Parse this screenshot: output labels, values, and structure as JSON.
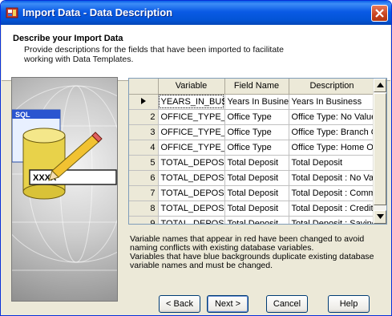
{
  "window": {
    "title": "Import Data - Data Description",
    "title_icon": "app-icon",
    "close_icon": "close-icon"
  },
  "header": {
    "title": "Describe your Import Data",
    "description": "Provide descriptions for the fields that have been imported to facilitate working with Data Templates."
  },
  "illustration": {
    "sql_label": "SQL",
    "field_label": "XXXX"
  },
  "grid": {
    "columns": [
      "Variable",
      "Field Name",
      "Description"
    ],
    "rows": [
      {
        "num": "",
        "variable": "YEARS_IN_BUSINESS",
        "field_name": "Years In Business",
        "description": "Years In Business",
        "current": true
      },
      {
        "num": "2",
        "variable": "OFFICE_TYPE_NO_VALUE",
        "field_name": "Office Type",
        "description": "Office Type: No Value"
      },
      {
        "num": "3",
        "variable": "OFFICE_TYPE_BRANCH",
        "field_name": "Office Type",
        "description": "Office Type: Branch Office"
      },
      {
        "num": "4",
        "variable": "OFFICE_TYPE_HOME",
        "field_name": "Office Type",
        "description": "Office Type: Home Office"
      },
      {
        "num": "5",
        "variable": "TOTAL_DEPOSIT",
        "field_name": "Total Deposit",
        "description": "Total Deposit"
      },
      {
        "num": "6",
        "variable": "TOTAL_DEPOSIT_NO_VALUE",
        "field_name": "Total Deposit",
        "description": "Total Deposit : No Value"
      },
      {
        "num": "7",
        "variable": "TOTAL_DEPOSIT_COMMERCIAL",
        "field_name": "Total Deposit",
        "description": "Total Deposit : Commercial"
      },
      {
        "num": "8",
        "variable": "TOTAL_DEPOSIT_CREDIT",
        "field_name": "Total Deposit",
        "description": "Total Deposit : Credit"
      },
      {
        "num": "9",
        "variable": "TOTAL_DEPOSIT_SAVINGS",
        "field_name": "Total Deposit",
        "description": "Total Deposit : Savings"
      }
    ]
  },
  "notes": {
    "line1": "Variable names that appear in red have been changed to avoid naming conflicts with existing database variables.",
    "line2": "Variables that have blue backgrounds duplicate existing database variable names and must be changed."
  },
  "buttons": {
    "back": "< Back",
    "next": "Next >",
    "cancel": "Cancel",
    "help": "Help"
  }
}
